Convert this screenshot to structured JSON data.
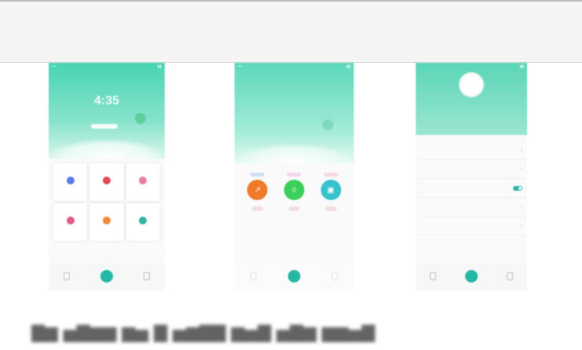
{
  "screens": {
    "sleep_home": {
      "header_title": "",
      "big_value": "4:35",
      "sub_value": "",
      "pill_label": "",
      "tiles": [
        {
          "label": "",
          "color": "#5b7be6"
        },
        {
          "label": "",
          "color": "#e24b5a"
        },
        {
          "label": "",
          "color": "#e57ea0"
        },
        {
          "label": "",
          "color": "#e05a87"
        },
        {
          "label": "",
          "color": "#f08a3a"
        },
        {
          "label": "",
          "color": "#2fb5a0"
        }
      ],
      "nav": [
        "",
        "",
        ""
      ]
    },
    "workout": {
      "actions": [
        {
          "label": "",
          "color": "#f07a2c",
          "ghost": "#cfe0f6"
        },
        {
          "label": "",
          "color": "#3bcf5b",
          "ghost": "#f6d3e6"
        },
        {
          "label": "",
          "color": "#36c1cc",
          "ghost": "#f8d6e2"
        }
      ]
    },
    "profile": {
      "avatar_text": "",
      "user_name": "",
      "stats": [
        "",
        "",
        ""
      ],
      "menu": [
        "",
        "",
        "",
        "",
        ""
      ],
      "toggle_on": true
    }
  },
  "accent": "#25b7a3"
}
